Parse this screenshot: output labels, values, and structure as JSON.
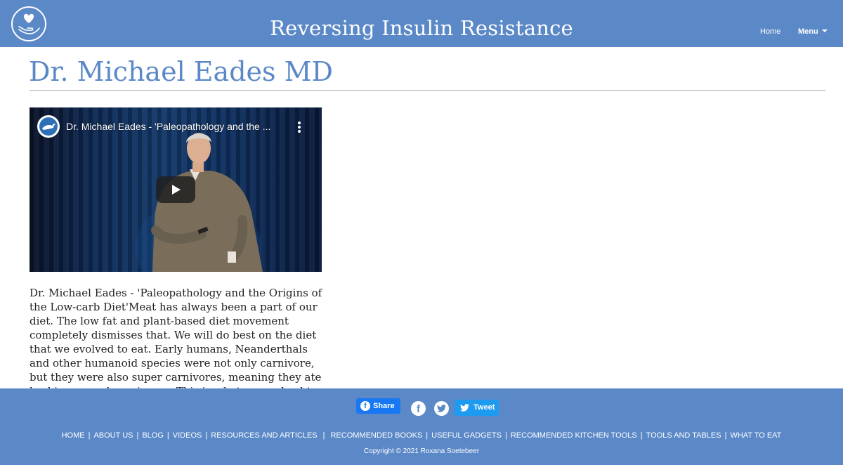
{
  "header": {
    "site_title": "Reversing Insulin Resistance",
    "nav": {
      "home_label": "Home",
      "menu_label": "Menu"
    }
  },
  "main": {
    "page_title": "Dr. Michael Eades MD",
    "video": {
      "title": "Dr. Michael Eades - 'Paleopathology and the ..."
    },
    "description": "Dr. Michael Eades - 'Paleopathology and the Origins of the Low-carb Diet'Meat has always been a part of our diet. The low fat and plant-based diet movement completely dismisses that. We will do best on the diet that we evolved to eat. Early humans, Neanderthals and other humanoid species were not only carnivore, but they were also super carnivores, meaning they ate herbivores and carnivores. This is what we evolved to"
  },
  "footer": {
    "share_label": "Share",
    "tweet_label": "Tweet",
    "nav_items": [
      "HOME",
      "ABOUT US",
      "BLOG",
      "VIDEOS",
      "RESOURCES AND ARTICLES",
      "RECOMMENDED BOOKS",
      "USEFUL GADGETS",
      "RECOMMENDED KITCHEN TOOLS",
      "TOOLS AND TABLES",
      "WHAT TO EAT"
    ],
    "separator": "|",
    "copyright": "Copyright © 2021 Roxana Soetebeer"
  },
  "colors": {
    "brand_blue": "#5b88c7",
    "facebook_blue": "#1877f2",
    "twitter_blue": "#1d9bf0"
  },
  "icons": {
    "logo": "heart-in-hand-icon",
    "channel": "kangaroo-channel-icon",
    "more": "more-vert-icon",
    "play": "play-icon",
    "facebook": "facebook-icon",
    "twitter": "twitter-icon"
  }
}
